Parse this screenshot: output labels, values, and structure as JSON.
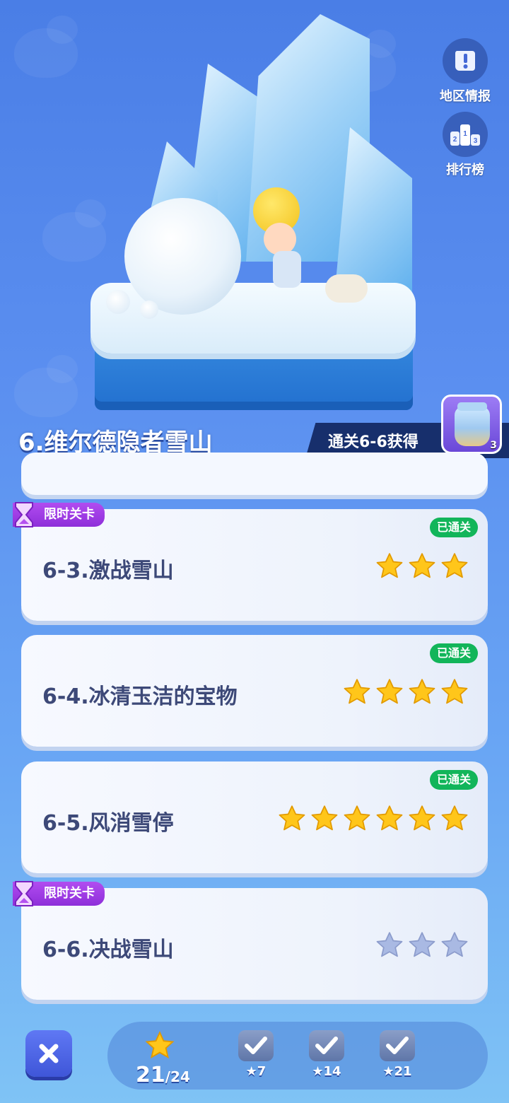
{
  "side_buttons": [
    {
      "label": "地区情报",
      "icon": "scroll-exclamation-icon"
    },
    {
      "label": "排行榜",
      "icon": "podium-icon"
    }
  ],
  "region": {
    "title": "6.维尔德隐者雪山",
    "reward_text": "通关6-6获得",
    "reward_item_icon": "snow-jar-icon",
    "reward_count": "3"
  },
  "levels": [
    {
      "title": "6-3.激战雪山",
      "limited": true,
      "limited_label": "限时关卡",
      "passed": true,
      "passed_label": "已通关",
      "stars_earned": 3,
      "stars_total": 3
    },
    {
      "title": "6-4.冰清玉洁的宝物",
      "limited": false,
      "passed": true,
      "passed_label": "已通关",
      "stars_earned": 4,
      "stars_total": 4
    },
    {
      "title": "6-5.风消雪停",
      "limited": false,
      "passed": true,
      "passed_label": "已通关",
      "stars_earned": 6,
      "stars_total": 6
    },
    {
      "title": "6-6.决战雪山",
      "limited": true,
      "limited_label": "限时关卡",
      "passed": false,
      "stars_earned": 0,
      "stars_total": 3
    }
  ],
  "progress": {
    "stars_current": "21",
    "stars_total": "/24",
    "milestones": [
      {
        "label": "7",
        "claimed": true
      },
      {
        "label": "14",
        "claimed": true
      },
      {
        "label": "21",
        "claimed": true
      }
    ]
  },
  "colors": {
    "star_gold": "#ffc61a",
    "star_empty": "#a9b9e3",
    "passed_green": "#12b55a",
    "limited_purple": "#9b3be4"
  }
}
